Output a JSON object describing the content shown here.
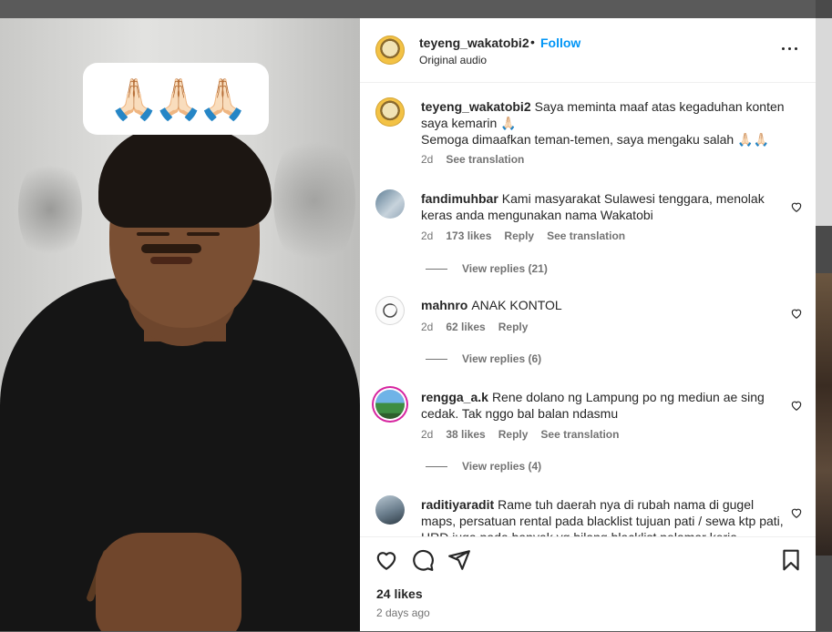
{
  "header": {
    "username": "teyeng_wakatobi2",
    "separator": "•",
    "follow_label": "Follow",
    "audio": "Original audio"
  },
  "video": {
    "sticker": "🙏🏻🙏🏻🙏🏻"
  },
  "comments": [
    {
      "username": "teyeng_wakatobi2",
      "text_line1": "Saya meminta maaf atas kegaduhan konten saya kemarin 🙏🏻",
      "text_line2": "Semoga dimaafkan teman-temen, saya mengaku salah 🙏🏻🙏🏻",
      "time": "2d",
      "see_translation": "See translation"
    },
    {
      "username": "fandimuhbar",
      "text": "Kami masyarakat Sulawesi tenggara, menolak keras anda mengunakan nama Wakatobi",
      "time": "2d",
      "likes": "173 likes",
      "reply": "Reply",
      "see_translation": "See translation",
      "view_replies": "View replies (21)"
    },
    {
      "username": "mahnro",
      "text": "ANAK KONTOL",
      "time": "2d",
      "likes": "62 likes",
      "reply": "Reply",
      "view_replies": "View replies (6)"
    },
    {
      "username": "rengga_a.k",
      "text": "Rene dolano ng Lampung po ng mediun ae sing cedak. Tak nggo bal balan ndasmu",
      "time": "2d",
      "likes": "38 likes",
      "reply": "Reply",
      "see_translation": "See translation",
      "view_replies": "View replies (4)"
    },
    {
      "username": "raditiyaradit",
      "text": "Rame tuh daerah nya di rubah nama di gugel maps, persatuan rental pada blacklist tujuan pati / sewa ktp pati, HRD juga pada banyak yg bilang blacklist pelamar kerja"
    }
  ],
  "footer": {
    "likes": "24 likes",
    "time": "2 days ago"
  },
  "icons": {
    "like": "heart-icon",
    "comment": "comment-icon",
    "share": "share-icon",
    "save": "bookmark-icon",
    "more": "more-options-icon"
  }
}
